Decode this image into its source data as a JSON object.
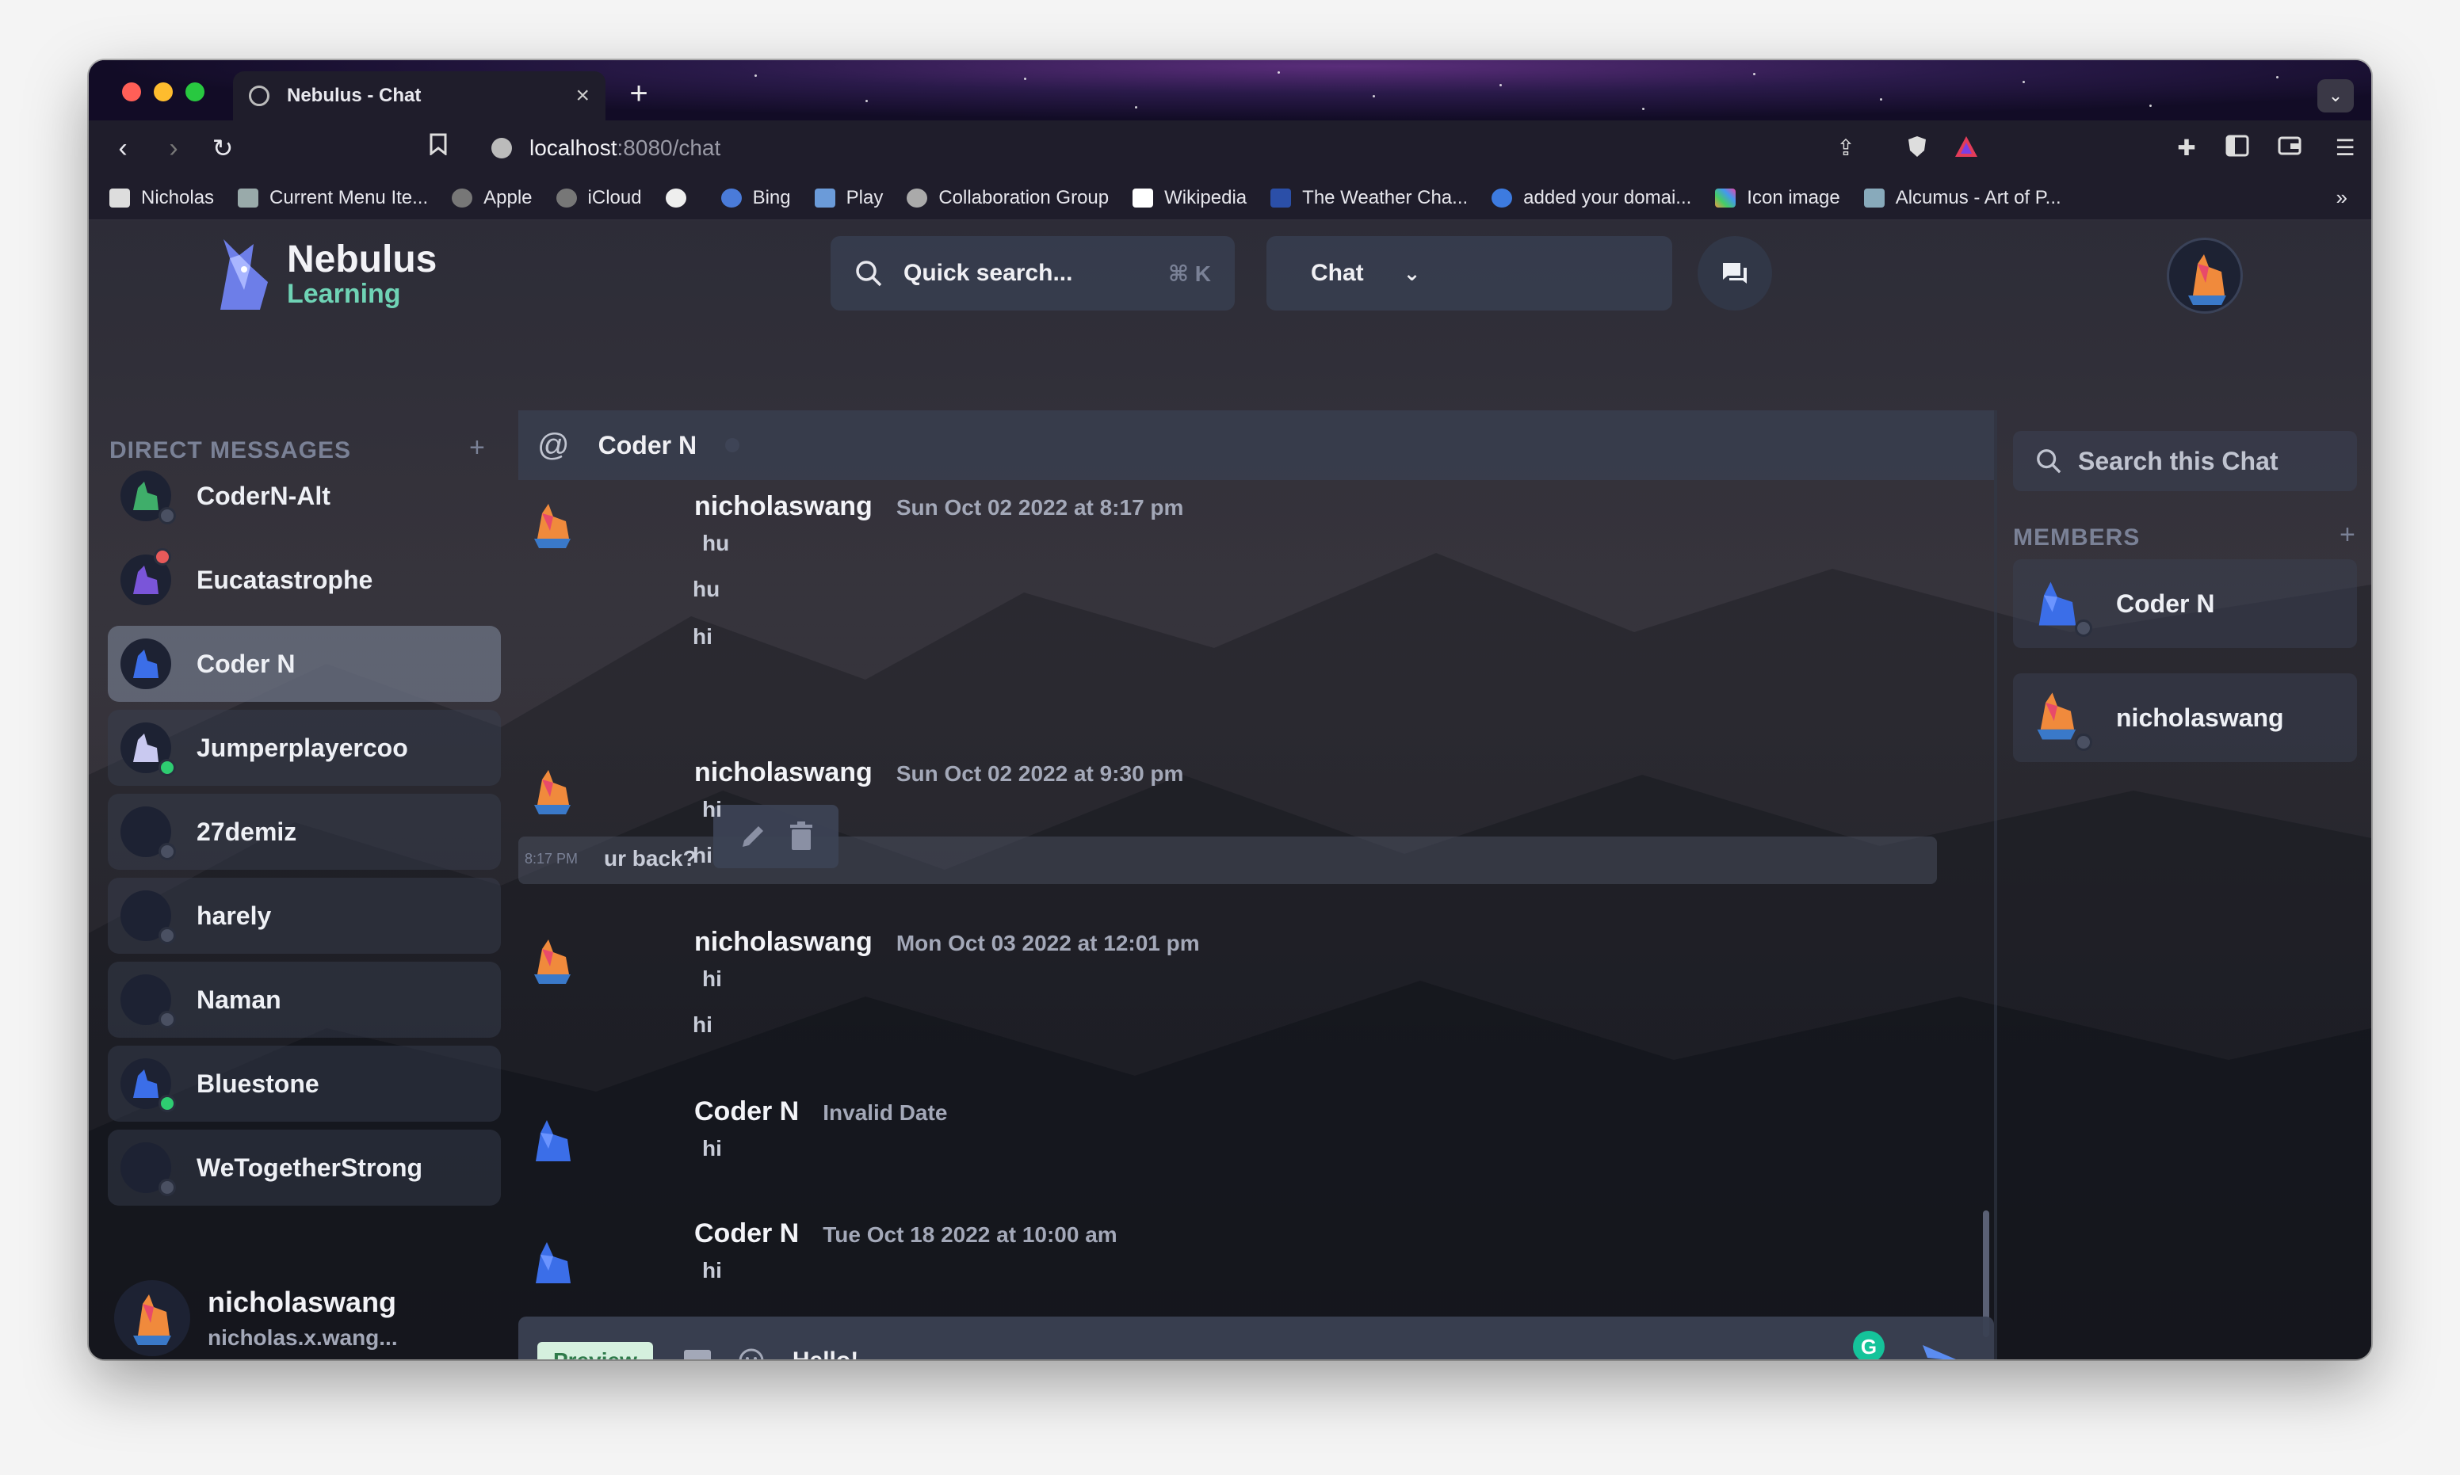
{
  "browser": {
    "tab_title": "Nebulus - Chat",
    "new_tab": "+",
    "url_host": "localhost",
    "url_path": ":8080/chat",
    "bookmarks": [
      {
        "label": "Nicholas",
        "icon": "folder-icon"
      },
      {
        "label": "Current Menu Ite...",
        "icon": "rocket-icon"
      },
      {
        "label": "Apple",
        "icon": "apple-icon"
      },
      {
        "label": "iCloud",
        "icon": "apple-icon"
      },
      {
        "label": "",
        "icon": "github-icon"
      },
      {
        "label": "Bing",
        "icon": "search-icon"
      },
      {
        "label": "Play",
        "icon": "cube-icon"
      },
      {
        "label": "Collaboration Group",
        "icon": "globe-icon"
      },
      {
        "label": "Wikipedia",
        "icon": "wikipedia-icon"
      },
      {
        "label": "The Weather Cha...",
        "icon": "weather-icon"
      },
      {
        "label": "added your domai...",
        "icon": "refresh-icon"
      },
      {
        "label": "Icon image",
        "icon": "pinwheel-icon"
      },
      {
        "label": "Alcumus - Art of P...",
        "icon": "cube-icon"
      }
    ],
    "bookmarks_more": "»"
  },
  "app": {
    "logo_title": "Nebulus",
    "logo_subtitle": "Learning",
    "search_placeholder": "Quick search...",
    "search_shortcut": "⌘ K",
    "chat_selector": "Chat",
    "sidebar": {
      "header": "DIRECT MESSAGES",
      "add": "+",
      "items": [
        {
          "name": "CoderN-Alt",
          "status": "offline",
          "avatar_color": "#3fae6a"
        },
        {
          "name": "Eucatastrophe",
          "status": "busy",
          "avatar_color": "#7a55d9"
        },
        {
          "name": "Coder N",
          "status": "active",
          "avatar_color": "#3b6ee8"
        },
        {
          "name": "Jumperplayercoo",
          "status": "online",
          "avatar_color": "#c9c9f0"
        },
        {
          "name": "27demiz",
          "status": "offline",
          "avatar_color": "#2a2a2a"
        },
        {
          "name": "harely",
          "status": "offline",
          "avatar_color": "#2a2a2a"
        },
        {
          "name": "Naman",
          "status": "offline",
          "avatar_color": "#2a2a2a"
        },
        {
          "name": "Bluestone",
          "status": "online",
          "avatar_color": "#3b6ee8"
        },
        {
          "name": "WeTogetherStrong",
          "status": "offline",
          "avatar_color": "#2a2a2a"
        }
      ],
      "current_user": {
        "name": "nicholaswang",
        "email": "nicholas.x.wang..."
      }
    },
    "chat": {
      "header_name": "Coder N",
      "hover_time": "8:17 PM",
      "groups": [
        {
          "author": "nicholaswang",
          "time": "Sun Oct 02 2022 at 8:17 pm",
          "lines": [
            "hu",
            "hu",
            "hi",
            "ur back?"
          ]
        },
        {
          "author": "nicholaswang",
          "time": "Sun Oct 02 2022 at 9:30 pm",
          "lines": [
            "hi",
            "hi"
          ]
        },
        {
          "author": "nicholaswang",
          "time": "Mon Oct 03 2022 at 12:01 pm",
          "lines": [
            "hi",
            "hi"
          ]
        },
        {
          "author": "Coder N",
          "time": "Invalid Date",
          "lines": [
            "hi"
          ]
        },
        {
          "author": "Coder N",
          "time": "Tue Oct 18 2022 at 10:00 am",
          "lines": [
            "hi"
          ]
        }
      ],
      "composer": {
        "preview_label": "Preview",
        "value": "Hello!",
        "grammarly": "G"
      }
    },
    "right_panel": {
      "search_placeholder": "Search this Chat",
      "members_header": "MEMBERS",
      "add": "+",
      "members": [
        {
          "name": "Coder N"
        },
        {
          "name": "nicholaswang"
        }
      ]
    }
  }
}
